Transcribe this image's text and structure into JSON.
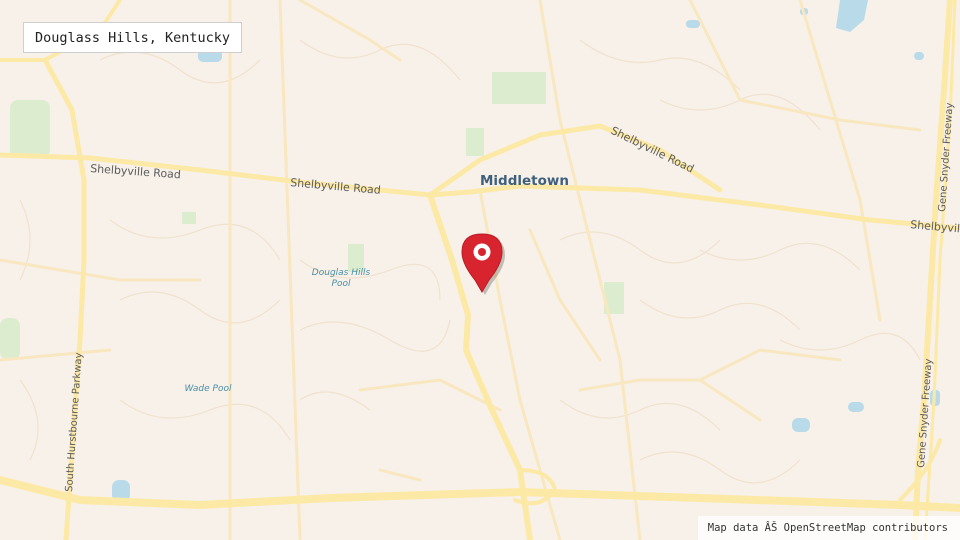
{
  "location_label": "Douglass Hills, Kentucky",
  "attribution": "Map data ÂŠ OpenStreetMap contributors",
  "map_labels": {
    "city": "Middletown",
    "road_shelbyville_1": "Shelbyville Road",
    "road_shelbyville_2": "Shelbyville Road",
    "road_shelbyville_3": "Shelbyville Road",
    "road_shelbyville_4": "Shelbyvil",
    "road_hurstbourne": "South Hurstbourne Parkway",
    "road_snyder_1": "Gene Snyder Freeway",
    "road_snyder_2": "Gene Snyder Freeway",
    "poi_pool_1_line1": "Douglas Hills",
    "poi_pool_1_line2": "Pool",
    "poi_pool_2": "Wade Pool"
  },
  "marker": {
    "icon": "map-pin-icon",
    "color": "#d8242f"
  },
  "colors": {
    "land": "#f7f1e9",
    "major_road": "#fde9a6",
    "minor_road": "#f9e7c0",
    "park": "#dbeccf",
    "water": "#b9dbe9",
    "city_label": "#3f5f7a",
    "poi_label": "#4a8fa8"
  }
}
